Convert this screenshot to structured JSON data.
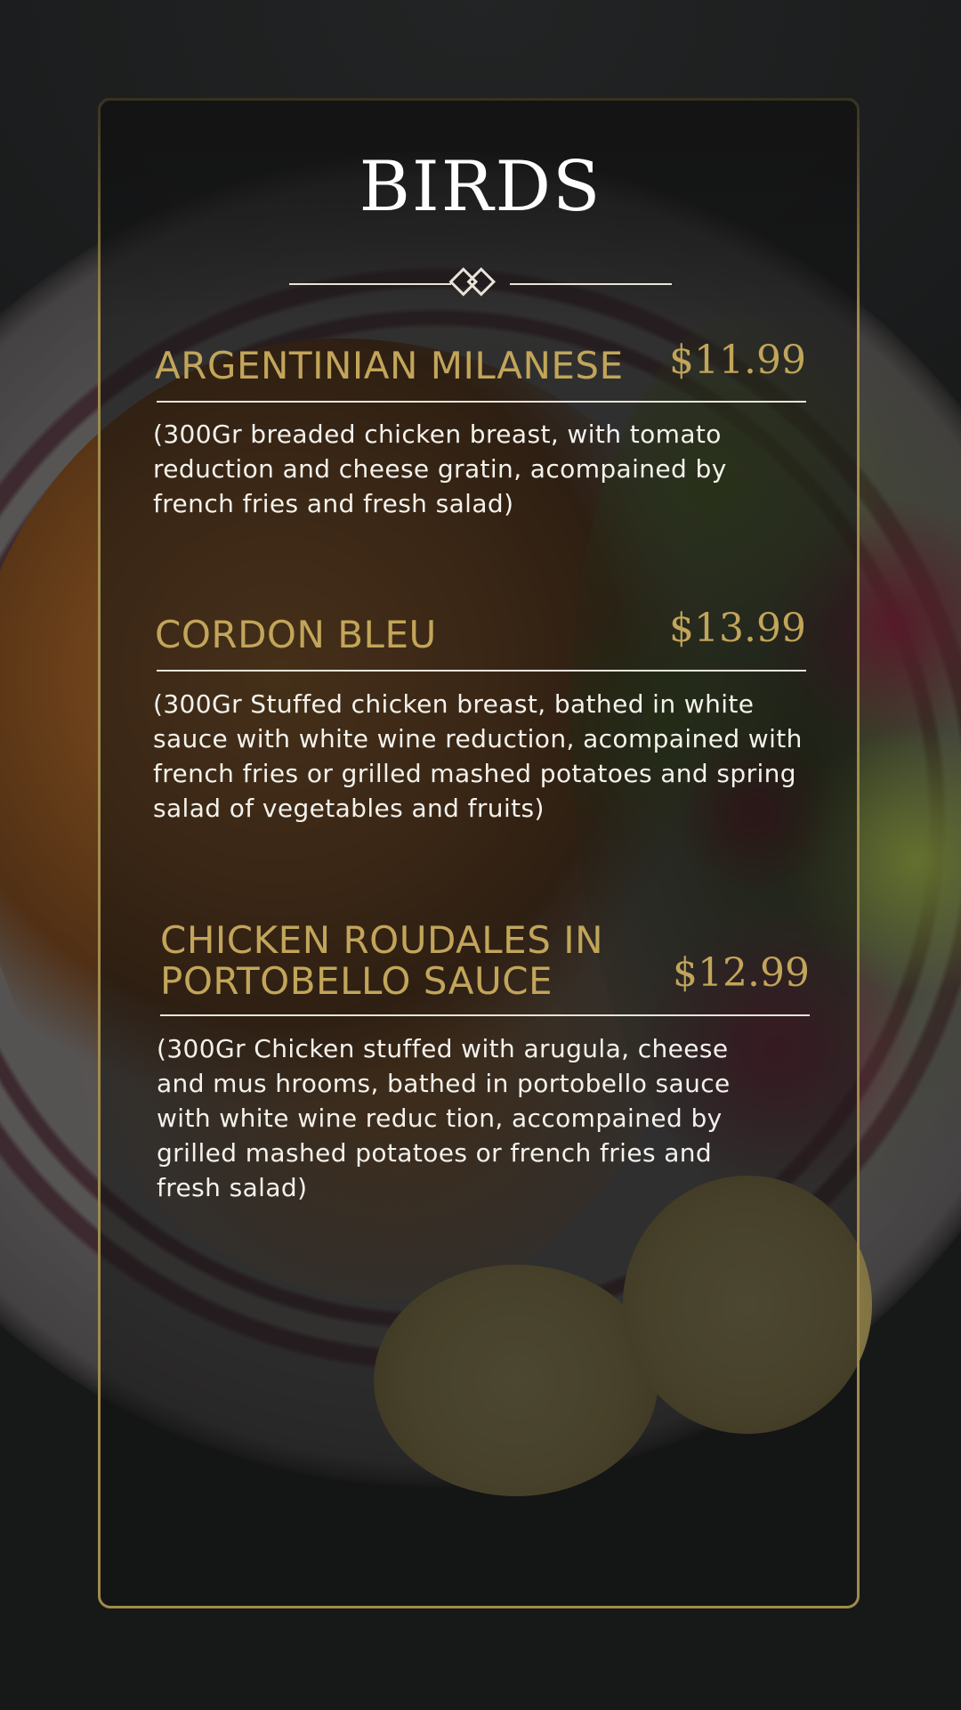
{
  "menu": {
    "title": "BIRDS",
    "items": [
      {
        "name": "ARGENTINIAN MILANESE",
        "price": "$11.99",
        "description": "(300Gr breaded chicken breast, with tomato reduction and cheese gratin, acompained by french fries and fresh salad)"
      },
      {
        "name": "CORDON BLEU",
        "price": "$13.99",
        "description": "(300Gr Stuffed chicken breast, bathed in white sauce with white wine reduction, acompained with french fries or grilled mashed potatoes and spring salad of vegetables and fruits)"
      },
      {
        "name_line1": "CHICKEN ROUDALES IN",
        "name_line2": "PORTOBELLO SAUCE",
        "price": "$12.99",
        "description": "(300Gr Chicken stuffed with arugula, cheese and mus hrooms, bathed in portobello sauce with white wine reduc tion, accompained by grilled mashed potatoes or french fries and fresh salad)"
      }
    ]
  },
  "colors": {
    "gold": "#c2a55a",
    "border": "#a08b4c",
    "text": "#f4f2ec",
    "title": "#ffffff"
  }
}
